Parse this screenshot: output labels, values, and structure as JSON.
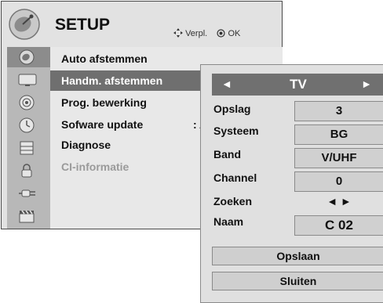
{
  "setup": {
    "title": "SETUP",
    "hint_move": "Verpl.",
    "hint_ok": "OK",
    "menu_items": [
      {
        "label": "Auto afstemmen",
        "value": ""
      },
      {
        "label": "Handm. afstemmen",
        "value": ""
      },
      {
        "label": "Prog. bewerking",
        "value": ""
      },
      {
        "label": "Sofware update",
        "value": ": A"
      },
      {
        "label": "Diagnose",
        "value": ""
      },
      {
        "label": "CI-informatie",
        "value": ""
      }
    ],
    "icons": [
      "satellite-dish-icon",
      "tv-screen-icon",
      "speaker-icon",
      "clock-icon",
      "lock-icon",
      "key-icon",
      "plug-icon",
      "clapperboard-icon"
    ]
  },
  "tuning": {
    "source": "TV",
    "rows": {
      "opslag": {
        "label": "Opslag",
        "value": "3"
      },
      "systeem": {
        "label": "Systeem",
        "value": "BG"
      },
      "band": {
        "label": "Band",
        "value": "V/UHF"
      },
      "channel": {
        "label": "Channel",
        "value": "0"
      },
      "zoeken": {
        "label": "Zoeken",
        "value": "◄ ►"
      },
      "naam": {
        "label": "Naam",
        "value": "C  02"
      }
    },
    "save_label": "Opslaan",
    "close_label": "Sluiten"
  },
  "colors": {
    "selected_bg": "#6f6f6f",
    "panel_bg": "#e0e0e0",
    "disabled_text": "#9a9a9a"
  }
}
